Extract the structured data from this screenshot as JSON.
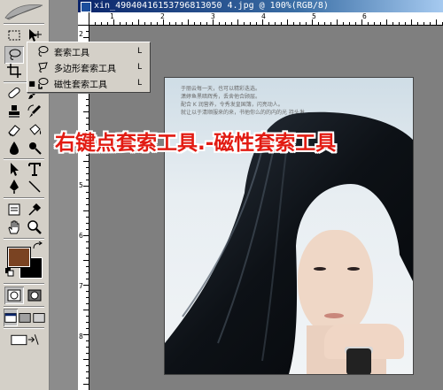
{
  "window": {
    "title": "xin_49040416153796813050 4.jpg @ 100%(RGB/8)"
  },
  "rulers": {
    "horizontal_labels": [
      "1",
      "2",
      "3",
      "4",
      "5",
      "6"
    ],
    "vertical_labels": [
      "2",
      "3",
      "4",
      "5",
      "6",
      "7",
      "8"
    ]
  },
  "flyout_menu": {
    "items": [
      {
        "label": "套索工具",
        "shortcut": "L",
        "icon": "lasso-icon",
        "selected": false
      },
      {
        "label": "多边形套索工具",
        "shortcut": "L",
        "icon": "polygonal-lasso-icon",
        "selected": false
      },
      {
        "label": "磁性套索工具",
        "shortcut": "L",
        "icon": "magnetic-lasso-icon",
        "selected": true
      }
    ]
  },
  "overlay": {
    "text": "右键点套索工具.-磁性套索工具"
  },
  "photo": {
    "caption": "于丽云每一天，也可以精彩迭选。\n潇婷鱼黑暗辉秀，丢舍他合顾层。\n配合 K 润营养，令秀发皇国簿，闪亮动人。\n就让以于清顺服来的来，书他你么的的内的光 持头发。"
  },
  "colors": {
    "foreground": "#7a4322",
    "background": "#000000",
    "overlay_text": "#e21b12",
    "titlebar": "#0a246a"
  },
  "toolbox": {
    "tools": [
      "rectangular-marquee-icon",
      "move-icon",
      "lasso-icon",
      "magic-wand-icon",
      "crop-icon",
      "slice-icon",
      "healing-brush-icon",
      "brush-icon",
      "clone-stamp-icon",
      "history-brush-icon",
      "eraser-icon",
      "paint-bucket-icon",
      "blur-icon",
      "dodge-icon",
      "path-selection-icon",
      "type-icon",
      "pen-icon",
      "line-icon",
      "notes-icon",
      "eyedropper-icon",
      "hand-icon",
      "zoom-icon"
    ]
  }
}
